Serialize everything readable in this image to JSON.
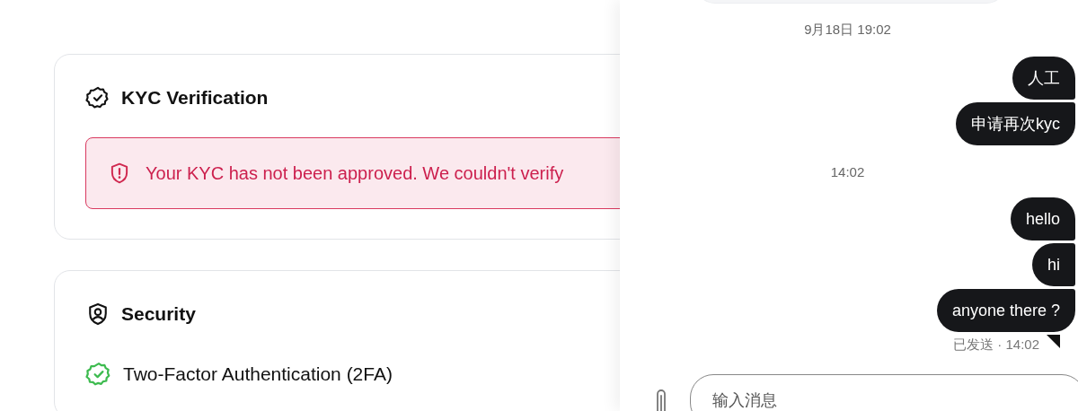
{
  "cards": [
    {
      "kind": "kyc",
      "title": "KYC Verification",
      "alert": "Your KYC has not been approved. We couldn't verify"
    },
    {
      "kind": "security",
      "title": "Security",
      "items": [
        {
          "label": "Two-Factor Authentication (2FA)",
          "enabled": true
        }
      ]
    }
  ],
  "chat": {
    "messages": [
      {
        "kind": "time",
        "text": "9月18日 19:02"
      },
      {
        "kind": "sent",
        "text": "人工"
      },
      {
        "kind": "sent",
        "text": "申请再次kyc"
      },
      {
        "kind": "time",
        "text": "14:02"
      },
      {
        "kind": "sent",
        "text": "hello"
      },
      {
        "kind": "sent",
        "text": "hi"
      },
      {
        "kind": "sent",
        "text": "anyone there ?",
        "status": "已发送 · 14:02"
      }
    ],
    "input": {
      "placeholder": "输入消息"
    }
  }
}
